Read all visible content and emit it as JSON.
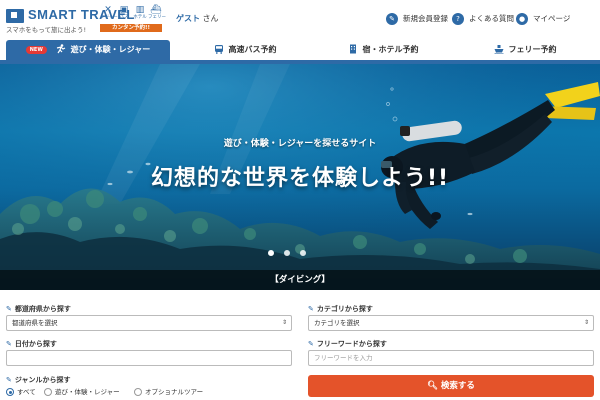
{
  "header": {
    "logo_text": "SMART TRAVEL",
    "tagline": "スマホをもって旅に出よう!",
    "services": [
      {
        "icon": "ticket-icon",
        "label": "レジャー"
      },
      {
        "icon": "bus-icon",
        "label": "バス"
      },
      {
        "icon": "hotel-icon",
        "label": "ホテル"
      },
      {
        "icon": "ferry-icon",
        "label": "フェリー"
      }
    ],
    "easy_badge": "カンタン予約!!",
    "guest_name": "ゲスト",
    "guest_suffix": "さん",
    "links": [
      {
        "icon": "edit-icon",
        "label": "新規会員登録"
      },
      {
        "icon": "question-icon",
        "label": "よくある質問"
      },
      {
        "icon": "user-icon",
        "label": "マイページ"
      }
    ]
  },
  "nav": {
    "new_badge": "NEW",
    "tabs": [
      {
        "label": "遊び・体験・レジャー",
        "icon": "activity-icon",
        "active": true
      },
      {
        "label": "高速バス予約",
        "icon": "bus-icon",
        "active": false
      },
      {
        "label": "宿・ホテル予約",
        "icon": "hotel-icon",
        "active": false
      },
      {
        "label": "フェリー予約",
        "icon": "ferry-icon",
        "active": false
      }
    ]
  },
  "hero": {
    "subtitle": "遊び・体験・レジャーを探せるサイト",
    "title": "幻想的な世界を体験しよう!!",
    "caption": "【ダイビング】",
    "slide_count": 3,
    "active_slide": 1
  },
  "form": {
    "prefecture": {
      "label": "都道府県から探す",
      "value": "都道府県を選択"
    },
    "category": {
      "label": "カテゴリから探す",
      "value": "カテゴリを選択"
    },
    "date": {
      "label": "日付から探す",
      "value": ""
    },
    "keyword": {
      "label": "フリーワードから探す",
      "placeholder": "フリーワードを入力"
    },
    "genre": {
      "label": "ジャンルから探す",
      "options": [
        "すべて",
        "遊び・体験・レジャー",
        "オプショナルツアー"
      ],
      "selected": "すべて"
    },
    "search_button": "検索する"
  },
  "colors": {
    "brand": "#2e6aa6",
    "accent": "#e4532a",
    "badge": "#e06a1b",
    "new": "#e53935"
  }
}
